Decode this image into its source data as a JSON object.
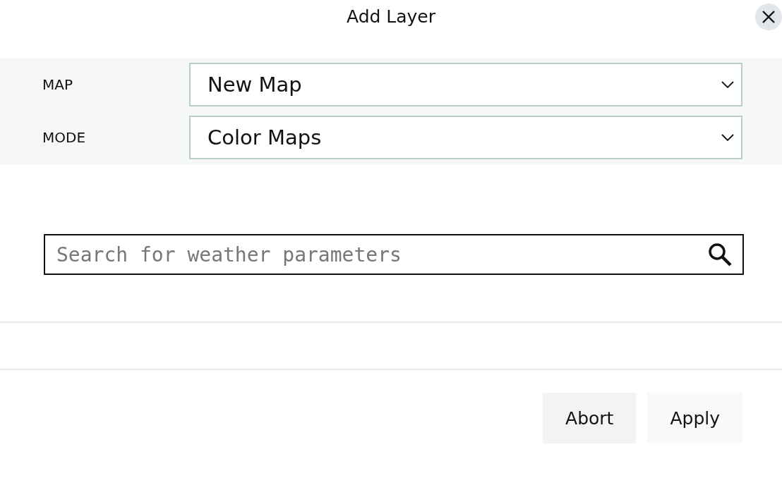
{
  "dialog": {
    "title": "Add Layer"
  },
  "fields": [
    {
      "label": "MAP",
      "value": "New Map"
    },
    {
      "label": "MODE",
      "value": "Color Maps"
    }
  ],
  "search": {
    "placeholder": "Search for weather parameters"
  },
  "buttons": [
    {
      "label": "Abort"
    },
    {
      "label": "Apply"
    }
  ]
}
